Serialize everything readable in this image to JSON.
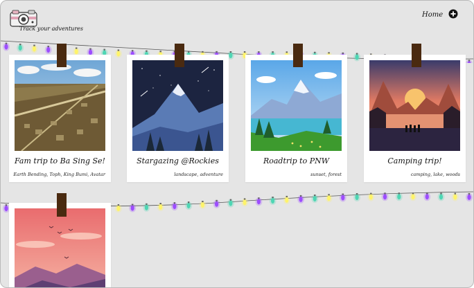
{
  "header": {
    "tagline": "Track your adventures",
    "home_label": "Home",
    "logo_icon": "camera-icon",
    "add_icon": "plus-circle-icon"
  },
  "cards": [
    {
      "title": "Fam trip to Ba Sing Se!",
      "tags": "Earth Bending, Toph, King Bumi, Avatar"
    },
    {
      "title": "Stargazing @Rockies",
      "tags": "landscape, adventure"
    },
    {
      "title": "Roadtrip to PNW",
      "tags": "sunset, forest"
    },
    {
      "title": "Camping trip!",
      "tags": "camping, lake, woods"
    },
    {
      "title": "",
      "tags": ""
    }
  ],
  "colors": {
    "background": "#e5e5e5",
    "clip": "#4a2a10",
    "light_purple": "#9d4dff",
    "light_yellow": "#fff46a",
    "light_teal": "#4fd6b4"
  }
}
